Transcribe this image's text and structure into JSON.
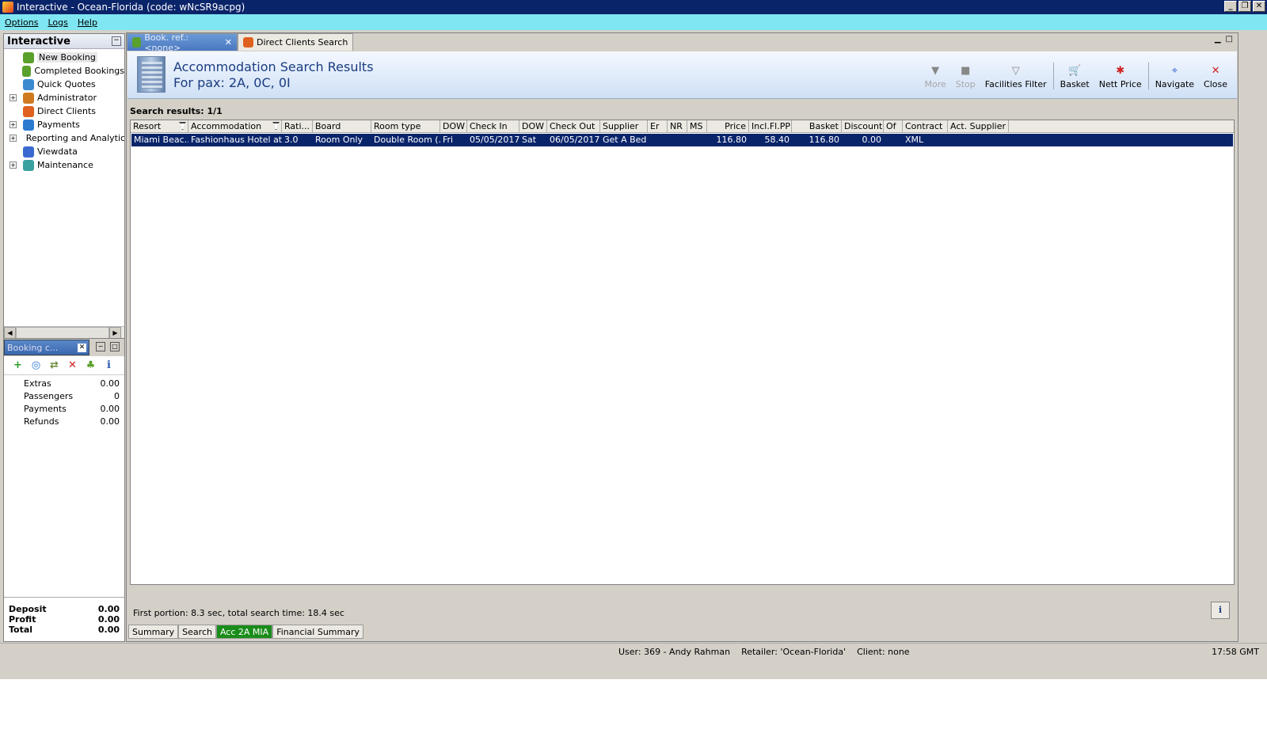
{
  "window": {
    "title": "Interactive - Ocean-Florida (code: wNcSR9acpg)",
    "controls": [
      "_",
      "❐",
      "✕"
    ]
  },
  "menu": [
    "Options",
    "Logs",
    "Help"
  ],
  "nav": {
    "title": "Interactive",
    "items": [
      {
        "label": "New Booking",
        "expandable": false,
        "color": "#5aa02c"
      },
      {
        "label": "Completed Bookings",
        "expandable": false,
        "color": "#5aa02c"
      },
      {
        "label": "Quick Quotes",
        "expandable": false,
        "color": "#3a8ad0"
      },
      {
        "label": "Administrator",
        "expandable": true,
        "color": "#d07a20"
      },
      {
        "label": "Direct Clients",
        "expandable": false,
        "color": "#e06020"
      },
      {
        "label": "Payments",
        "expandable": true,
        "color": "#2a7ad0"
      },
      {
        "label": "Reporting and Analytics",
        "expandable": true,
        "color": "#3aa040"
      },
      {
        "label": "Viewdata",
        "expandable": false,
        "color": "#3a6ad0"
      },
      {
        "label": "Maintenance",
        "expandable": true,
        "color": "#3aa0a0"
      }
    ]
  },
  "booking_panel": {
    "tab_label": "Booking c...",
    "rows": [
      {
        "label": "Extras",
        "value": "0.00"
      },
      {
        "label": "Passengers",
        "value": "0"
      },
      {
        "label": "Payments",
        "value": "0.00"
      },
      {
        "label": "Refunds",
        "value": "0.00"
      }
    ],
    "totals": [
      {
        "label": "Deposit",
        "value": "0.00"
      },
      {
        "label": "Profit",
        "value": "0.00"
      },
      {
        "label": "Total",
        "value": "0.00"
      }
    ]
  },
  "doc_tabs": [
    {
      "label": "Book. ref.: <none>",
      "active": true
    },
    {
      "label": "Direct Clients Search",
      "active": false
    }
  ],
  "header": {
    "title": "Accommodation Search Results",
    "subtitle": "For pax: 2A, 0C, 0I",
    "buttons": [
      {
        "label": "More",
        "icon": "▼",
        "disabled": true
      },
      {
        "label": "Stop",
        "icon": "■",
        "disabled": true
      },
      {
        "label": "Facilities Filter",
        "icon": "▽",
        "disabled": false
      },
      {
        "label": "Basket",
        "icon": "🛒",
        "disabled": false
      },
      {
        "label": "Nett Price",
        "icon": "✱",
        "disabled": false
      },
      {
        "label": "Navigate",
        "icon": "⌖",
        "disabled": false
      },
      {
        "label": "Close",
        "icon": "✕",
        "disabled": false
      }
    ]
  },
  "results": {
    "label": "Search results: 1/1",
    "columns": [
      "Resort",
      "Accommodation",
      "Rati...",
      "Board",
      "Room type",
      "DOW",
      "Check In",
      "DOW",
      "Check Out",
      "Supplier",
      "Er",
      "NR",
      "MS",
      "Price",
      "Incl.Fl.PP",
      "Basket",
      "Discount",
      "Of",
      "Contract",
      "Act. Supplier"
    ],
    "rows": [
      [
        "Miami Beac...",
        "Fashionhaus Hotel at...",
        "3.0",
        "Room Only",
        "Double Room (...",
        "Fri",
        "05/05/2017",
        "Sat",
        "06/05/2017",
        "Get A Bed",
        "",
        "",
        "",
        "116.80",
        "58.40",
        "116.80",
        "0.00",
        "",
        "XML",
        ""
      ]
    ]
  },
  "status_line": "First portion: 8.3 sec, total search time: 18.4 sec",
  "bottom_tabs": [
    {
      "label": "Summary",
      "active": false
    },
    {
      "label": "Search",
      "active": false
    },
    {
      "label": "Acc 2A MIA",
      "active": true
    },
    {
      "label": "Financial Summary",
      "active": false
    }
  ],
  "statusbar": {
    "user": "User: 369 - Andy Rahman",
    "retailer": "Retailer: 'Ocean-Florida'",
    "client": "Client: none",
    "time": "17:58 GMT"
  }
}
